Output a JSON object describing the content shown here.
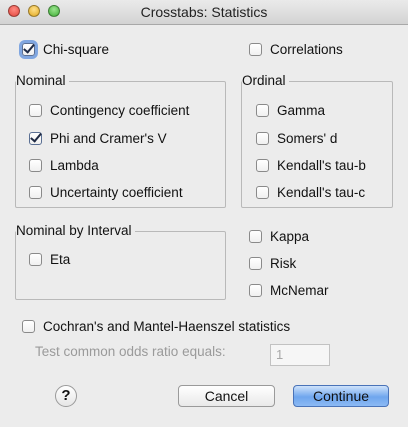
{
  "window": {
    "title": "Crosstabs: Statistics"
  },
  "top": {
    "chi_square": {
      "label": "Chi-square",
      "checked": true
    },
    "correlations": {
      "label": "Correlations",
      "checked": false
    }
  },
  "nominal": {
    "label": "Nominal",
    "items": [
      {
        "label": "Contingency coefficient",
        "checked": false
      },
      {
        "label": "Phi and Cramer's V",
        "checked": true
      },
      {
        "label": "Lambda",
        "checked": false
      },
      {
        "label": "Uncertainty coefficient",
        "checked": false
      }
    ]
  },
  "ordinal": {
    "label": "Ordinal",
    "items": [
      {
        "label": "Gamma",
        "checked": false
      },
      {
        "label": "Somers' d",
        "checked": false
      },
      {
        "label": "Kendall's tau-b",
        "checked": false
      },
      {
        "label": "Kendall's tau-c",
        "checked": false
      }
    ]
  },
  "nominal_by_interval": {
    "label": "Nominal by Interval",
    "items": [
      {
        "label": "Eta",
        "checked": false
      }
    ]
  },
  "other": {
    "items": [
      {
        "label": "Kappa",
        "checked": false
      },
      {
        "label": "Risk",
        "checked": false
      },
      {
        "label": "McNemar",
        "checked": false
      }
    ]
  },
  "cmh": {
    "label": "Cochran's and Mantel-Haenszel statistics",
    "checked": false,
    "odds_label": "Test common odds ratio equals:",
    "odds_value": "1"
  },
  "buttons": {
    "help": "?",
    "cancel": "Cancel",
    "continue": "Continue"
  }
}
